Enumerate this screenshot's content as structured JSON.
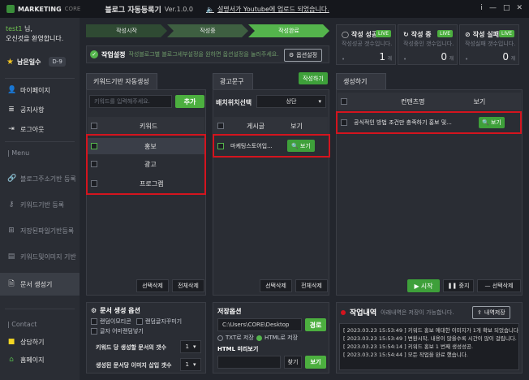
{
  "titlebar": {
    "brand": "MARKETING",
    "brand_sub": "CORE",
    "app_title": "블로그 자동등록기",
    "version": "Ver.1.0.0",
    "notice": "설명서가 Youtube에 업로드 되었습니다.",
    "controls": [
      "i",
      "—",
      "□",
      "✕"
    ]
  },
  "sidebar": {
    "user_name": "test1",
    "user_suffix": " 님,",
    "welcome": "오신것을 환영합니다.",
    "remain_label": "남은일수",
    "remain_value": "D-9",
    "items": [
      {
        "label": "마이페이지",
        "icon": "user-icon"
      },
      {
        "label": "공지사항",
        "icon": "list-icon"
      },
      {
        "label": "로그아웃",
        "icon": "logout-icon"
      }
    ],
    "menu_header": "| Menu",
    "menu_items": [
      {
        "label": "블로그주소기반 등록",
        "icon": "link-icon"
      },
      {
        "label": "키워드기반 등록",
        "icon": "key-icon"
      },
      {
        "label": "저장된파일기반등록",
        "icon": "file-plus-icon"
      },
      {
        "label": "키워드및이미지 기반",
        "icon": "image-file-icon"
      },
      {
        "label": "문서 생성기",
        "icon": "document-icon"
      }
    ],
    "contact_header": "| Contact",
    "contact_items": [
      {
        "label": "상담하기",
        "icon": "chat-icon"
      },
      {
        "label": "홈페이지",
        "icon": "home-icon"
      }
    ]
  },
  "progress": {
    "steps": [
      "작성시작",
      "작성중",
      "작성완료"
    ]
  },
  "option_bar": {
    "label": "작업설정",
    "desc": "작성블로그별 블로그세부설정을 원하면 옵션설정을 눌러주세요.",
    "button": "옵션설정"
  },
  "stats": [
    {
      "title": "작성 성공",
      "sub": "작성성공 갯수입니다.",
      "value": "1",
      "unit": "개",
      "badge": "LIVE"
    },
    {
      "title": "작성 중",
      "sub": "작성중인 갯수입니다.",
      "value": "0",
      "unit": "개",
      "badge": "LIVE"
    },
    {
      "title": "작성 실패",
      "sub": "작성실패 갯수입니다.",
      "value": "0",
      "unit": "개",
      "badge": "LIVE"
    }
  ],
  "keyword_panel": {
    "tab": "키워드기반 자동생성",
    "input_placeholder": "키워드를 입력해주세요.",
    "add_button": "추가",
    "col_header": "키워드",
    "rows": [
      "홍보",
      "광고",
      "프로그램"
    ],
    "delete_selected": "선택삭제",
    "delete_all": "전체삭제"
  },
  "ad_panel": {
    "tab": "광고문구",
    "write_button": "작성하기",
    "position_label": "배치위치선택",
    "position_value": "상단",
    "col_post": "게시글",
    "col_view": "보기",
    "rows": [
      {
        "title": "마케팅스토어입...",
        "view": "보기"
      }
    ],
    "delete_selected": "선택삭제",
    "delete_all": "전체삭제"
  },
  "gen_panel": {
    "tab": "생성하기",
    "col_content": "컨텐츠명",
    "col_view": "보기",
    "rows": [
      {
        "title": "공식적인 방법 조건만 충족하기  홍보 및...",
        "view": "보기"
      }
    ],
    "start_button": "시작",
    "stop_button": "중지",
    "delete_selected": "선택삭제"
  },
  "doc_options": {
    "title": "문서 생성 옵션",
    "checks": [
      "랜덤이모티콘",
      "랜덤글자꾸미기",
      "글자 어미랜덤넣기"
    ],
    "fields": [
      {
        "label": "키워드 당 생성할 문서의 갯수",
        "value": "1"
      },
      {
        "label": "생성된 문서당 이미지 삽입 갯수",
        "value": "1"
      }
    ]
  },
  "save_options": {
    "title": "저장옵션",
    "path": "C:\\Users\\CORE\\Desktop",
    "path_button": "경로",
    "txt_label": "TXT로 저장",
    "html_label": "HTML로 저장",
    "preview_label": "HTML 미리보기",
    "find_button": "찾기",
    "view_button": "보기"
  },
  "log": {
    "title": "작업내역",
    "desc": "아래내역은 저장이 가능합니다.",
    "save_button": "내역저장",
    "lines": [
      "[ 2023.03.23 15:53:49 ] 키워드 홍보 에대한 이미지가 1개 확보 되었습니다.",
      "[ 2023.03.23 15:53:49 ] 변환시작, 내용이 많을수록 시간이 많이 걸립니다.",
      "[ 2023.03.23 15:54:14 ] 키워드 홍보 1 번째 생성성공.",
      "[ 2023.03.23 15:54:44 ] 모든 작업을 완료 했습니다."
    ]
  }
}
